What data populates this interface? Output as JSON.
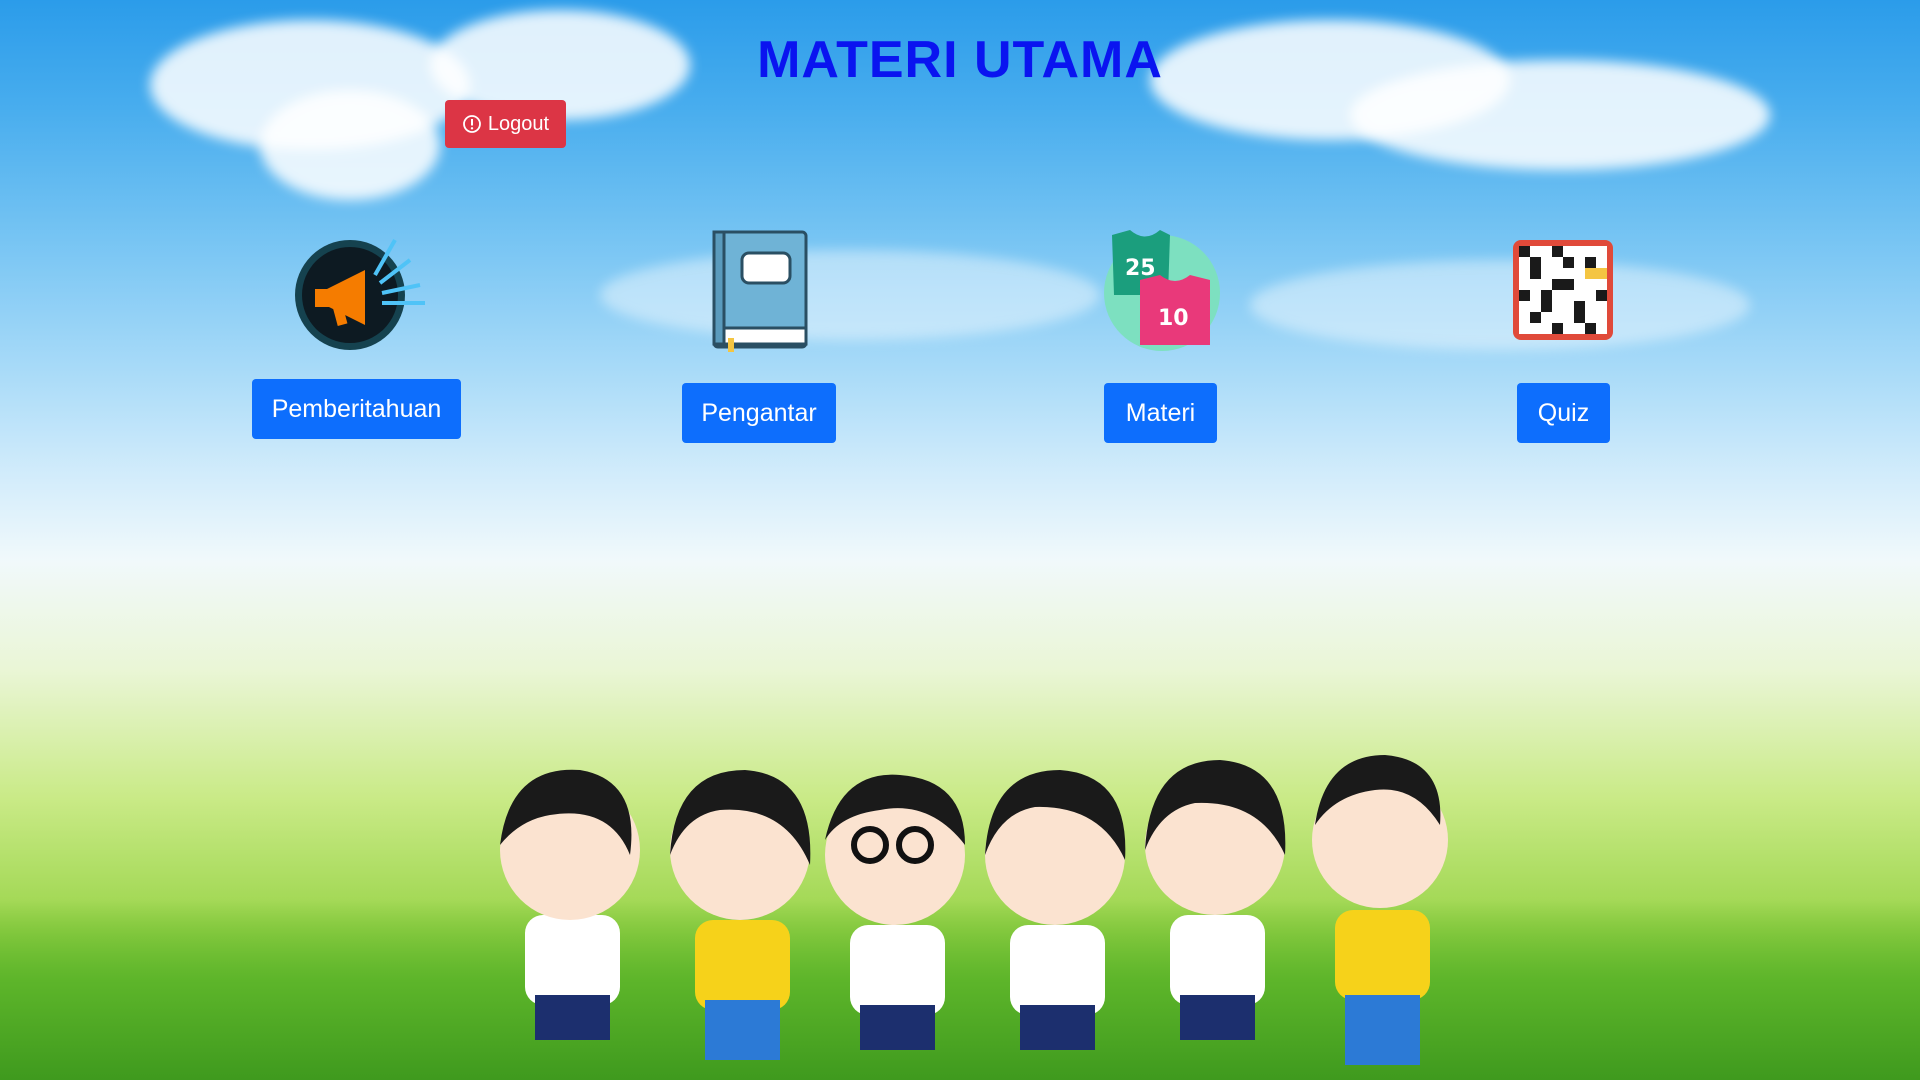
{
  "page": {
    "title": "MATERI UTAMA",
    "title_color": "#0a14f0"
  },
  "logout": {
    "label": "Logout",
    "icon": "alert-circle-icon",
    "color": "#dc3545"
  },
  "menu": {
    "button_color": "#0d6efd",
    "items": [
      {
        "label": "Pemberitahuan",
        "icon": "megaphone-icon"
      },
      {
        "label": "Pengantar",
        "icon": "book-icon"
      },
      {
        "label": "Materi",
        "icon": "jersey-icon"
      },
      {
        "label": "Quiz",
        "icon": "crossword-icon"
      }
    ]
  },
  "illustration": {
    "name": "children-group-illustration"
  }
}
